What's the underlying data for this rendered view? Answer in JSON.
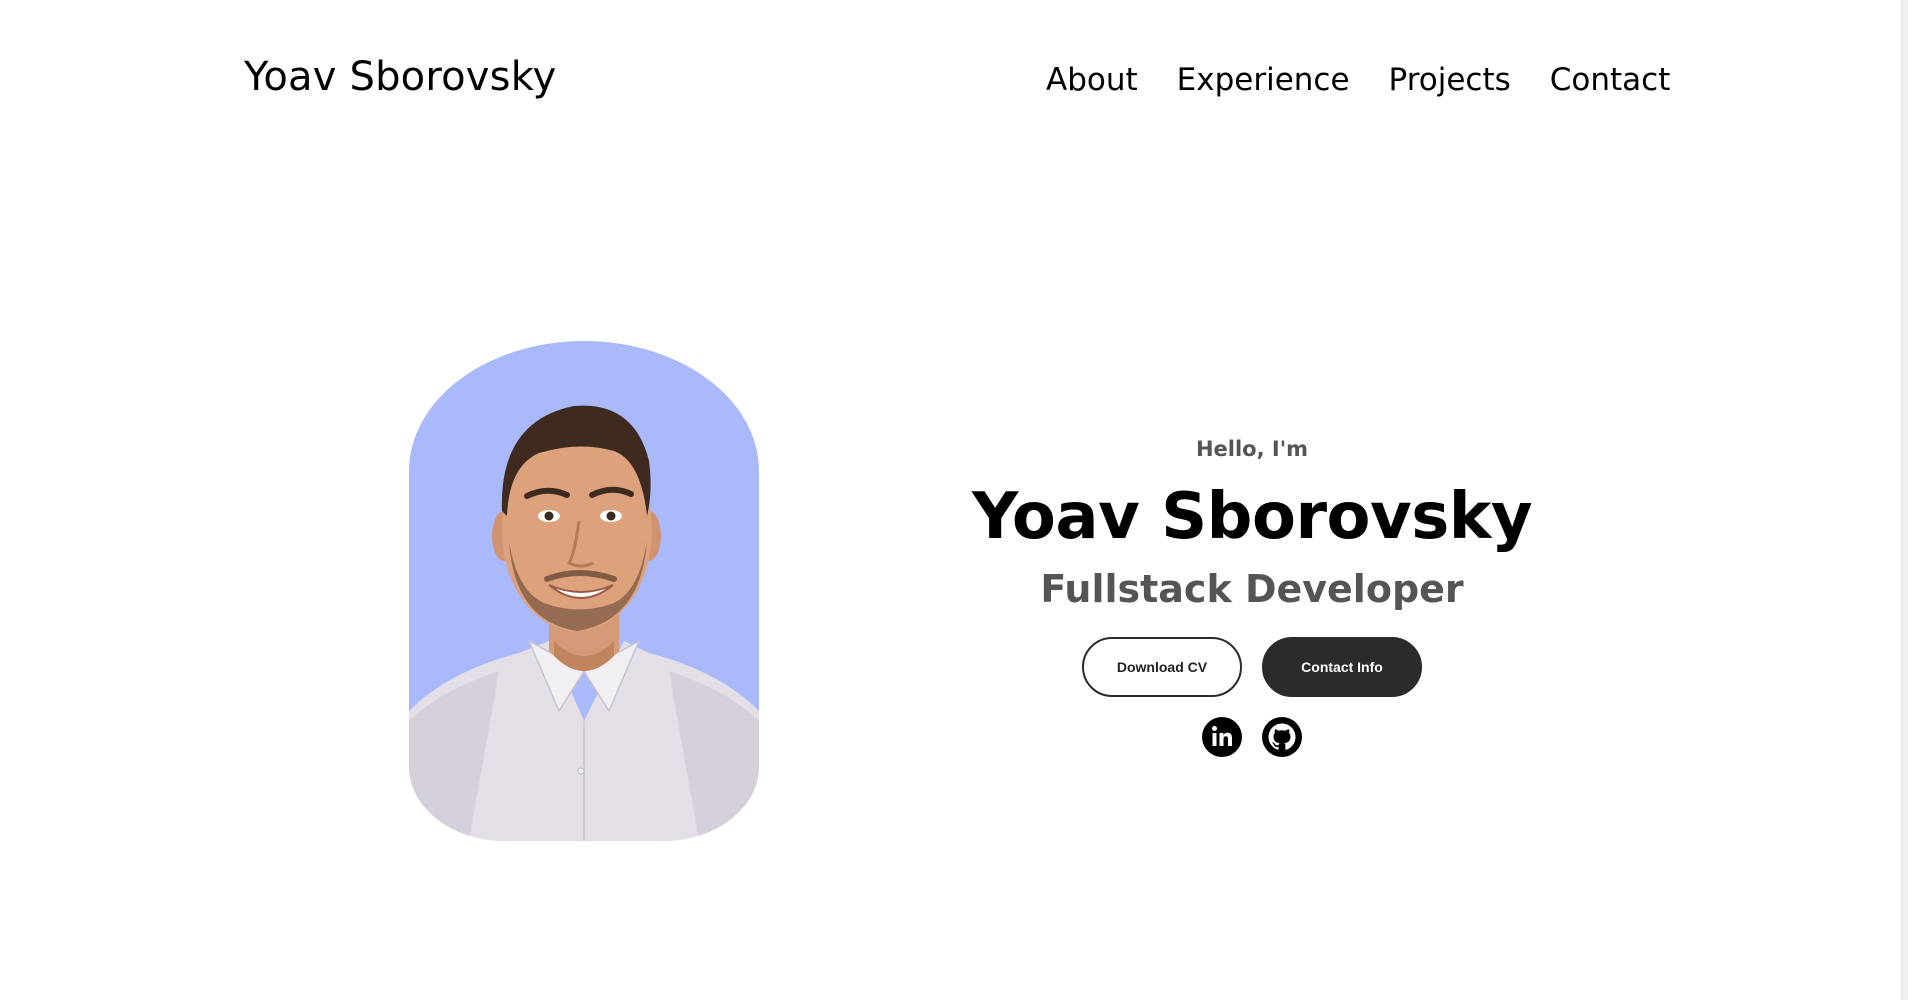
{
  "header": {
    "logo": "Yoav Sborovsky",
    "nav": [
      {
        "label": "About"
      },
      {
        "label": "Experience"
      },
      {
        "label": "Projects"
      },
      {
        "label": "Contact"
      }
    ]
  },
  "profile": {
    "photo_icon": "profile-photo",
    "photo_background": "#aab9fb"
  },
  "hero": {
    "greeting": "Hello, I'm",
    "name": "Yoav Sborovsky",
    "title": "Fullstack Developer",
    "buttons": {
      "download_cv": "Download CV",
      "contact_info": "Contact Info"
    },
    "socials": [
      {
        "icon": "linkedin-icon"
      },
      {
        "icon": "github-icon"
      }
    ]
  },
  "colors": {
    "text_primary": "#000000",
    "text_secondary": "#555555",
    "button_dark": "#2b2b2b",
    "background": "#ffffff"
  }
}
